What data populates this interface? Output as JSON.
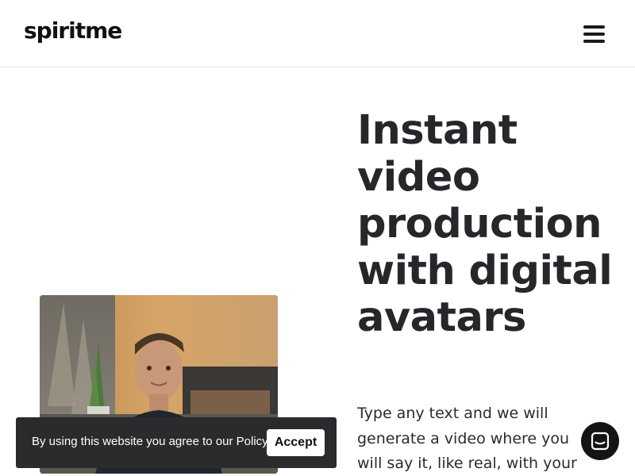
{
  "header": {
    "logo": "spiritme"
  },
  "hero": {
    "title": "Instant video production with digital avatars",
    "subtitle": "Type any text and we will generate a video where you will say it, like real, with your"
  },
  "video": {
    "description_icon": "presenter-video-thumbnail"
  },
  "cookie_banner": {
    "text": "By using this website you agree to our Policy.",
    "accept_label": "Accept"
  },
  "chat": {
    "icon": "chat-bubble-icon"
  },
  "colors": {
    "text_dark": "#26262b",
    "banner_bg": "#2b2b2e",
    "chat_bg": "#141414"
  }
}
